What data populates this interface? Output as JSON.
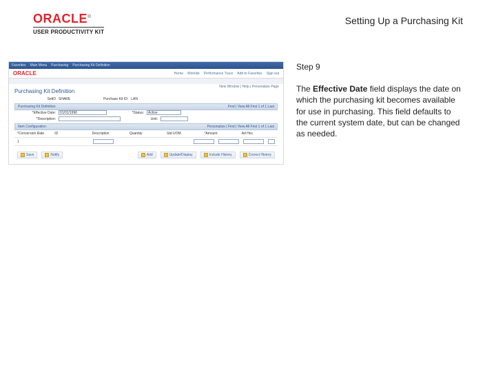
{
  "brand": {
    "name": "ORACLE",
    "tm": "®",
    "product": "USER PRODUCTIVITY KIT"
  },
  "page_title": "Setting Up a Purchasing Kit",
  "screenshot": {
    "top_menu": [
      "Favorites",
      "Main Menu",
      "Purchasing",
      "Purchasing Kit Definition"
    ],
    "nav": [
      "Home",
      "Worklist",
      "Performance Trace",
      "Add to Favorites",
      "Sign out"
    ],
    "crumb": "New Window | Help | Personalize Page",
    "title": "Purchasing Kit Definition",
    "row1_label": "SetID",
    "row1_val": "SHARE",
    "row1b_label": "Purchase Kit ID:",
    "row1b_val": "LAN",
    "section1": "Purchasing Kit Definition",
    "sec1_pager": "Find | View All   First  1 of 1  Last",
    "effdate_label": "*Effective Date:",
    "effdate_val": "01/01/1990",
    "status_label": "*Status:",
    "status_val": "Active",
    "desc_label": "*Description:",
    "unit_label": "Unit:",
    "section2": "Item Configuration",
    "sec2_pager": "Personalize | Find | View All   First  1 of 1  Last",
    "cols": [
      "*Conversion Rate",
      "ID",
      "Description",
      "Quantity",
      "Std UOM",
      "*Amount",
      "Ad Hoc"
    ],
    "row_num": "1",
    "footer": {
      "save": "Save",
      "notify": "Notify",
      "add": "Add",
      "upd": "Update/Display",
      "hist": "Include History",
      "corr": "Correct History"
    }
  },
  "step_label": "Step 9",
  "description_parts": {
    "pre": "The ",
    "bold": "Effective Date",
    "post": " field displays the date on which the purchasing kit becomes available for use in purchasing. This field defaults to the current system date, but can be changed as needed."
  }
}
